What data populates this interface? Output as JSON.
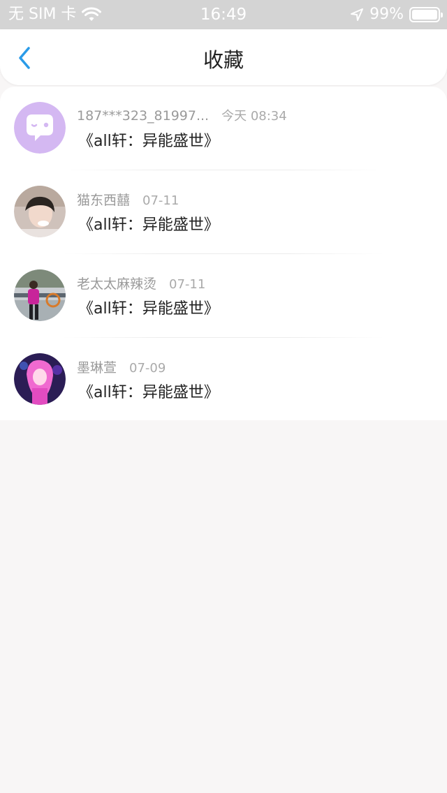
{
  "status_bar": {
    "carrier": "无 SIM 卡",
    "time": "16:49",
    "battery": "99%",
    "battery_level": 0.99
  },
  "nav": {
    "title": "收藏",
    "back_icon": "chevron-left-icon",
    "accent": "#2a9be8"
  },
  "items": [
    {
      "name": "187***323_81997...",
      "time": "今天 08:34",
      "content": "《all轩：异能盛世》",
      "avatar": "chat-bubble-avatar"
    },
    {
      "name": "猫东西囍",
      "time": "07-11",
      "content": "《all轩：异能盛世》",
      "avatar": "photo-avatar"
    },
    {
      "name": "老太太麻辣烫",
      "time": "07-11",
      "content": "《all轩：异能盛世》",
      "avatar": "photo-avatar"
    },
    {
      "name": "墨琳萱",
      "time": "07-09",
      "content": "《all轩：异能盛世》",
      "avatar": "photo-avatar"
    }
  ]
}
